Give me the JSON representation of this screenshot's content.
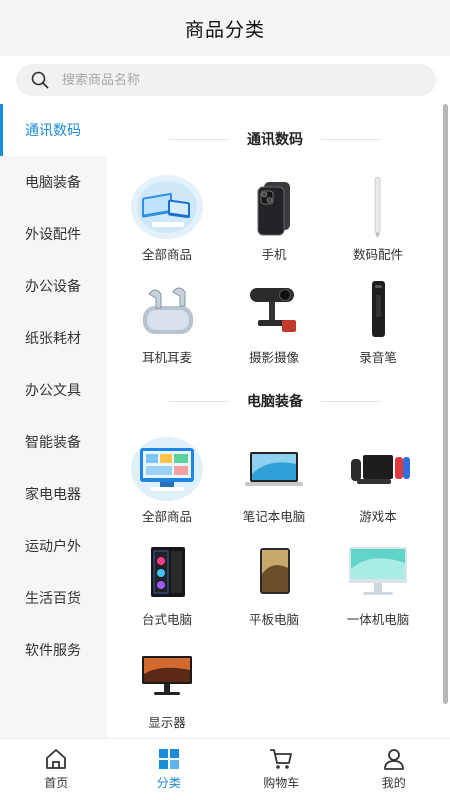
{
  "header": {
    "title": "商品分类"
  },
  "search": {
    "placeholder": "搜索商品名称"
  },
  "sidebar": {
    "items": [
      {
        "label": "通讯数码",
        "active": true
      },
      {
        "label": "电脑装备"
      },
      {
        "label": "外设配件"
      },
      {
        "label": "办公设备"
      },
      {
        "label": "纸张耗材"
      },
      {
        "label": "办公文具"
      },
      {
        "label": "智能装备"
      },
      {
        "label": "家电电器"
      },
      {
        "label": "运动户外"
      },
      {
        "label": "生活百货"
      },
      {
        "label": "软件服务"
      }
    ]
  },
  "sections": [
    {
      "title": "通讯数码",
      "items": [
        {
          "label": "全部商品",
          "icon": "all-products-image"
        },
        {
          "label": "手机",
          "icon": "phone-image"
        },
        {
          "label": "数码配件",
          "icon": "stylus-image"
        },
        {
          "label": "耳机耳麦",
          "icon": "earbuds-image"
        },
        {
          "label": "摄影摄像",
          "icon": "webcam-image"
        },
        {
          "label": "录音笔",
          "icon": "voice-recorder-image"
        }
      ]
    },
    {
      "title": "电脑装备",
      "items": [
        {
          "label": "全部商品",
          "icon": "all-products-image"
        },
        {
          "label": "笔记本电脑",
          "icon": "laptop-image"
        },
        {
          "label": "游戏本",
          "icon": "game-console-image"
        },
        {
          "label": "台式电脑",
          "icon": "desktop-tower-image"
        },
        {
          "label": "平板电脑",
          "icon": "tablet-image"
        },
        {
          "label": "一体机电脑",
          "icon": "all-in-one-image"
        },
        {
          "label": "显示器",
          "icon": "monitor-image"
        }
      ]
    }
  ],
  "tabbar": {
    "items": [
      {
        "label": "首页",
        "icon": "home-icon"
      },
      {
        "label": "分类",
        "icon": "category-icon",
        "active": true
      },
      {
        "label": "购物车",
        "icon": "cart-icon"
      },
      {
        "label": "我的",
        "icon": "user-icon"
      }
    ]
  },
  "colors": {
    "accent": "#1a8cd8",
    "sidebar_bg": "#f6f6f6",
    "search_bg": "#f1f1f1"
  }
}
